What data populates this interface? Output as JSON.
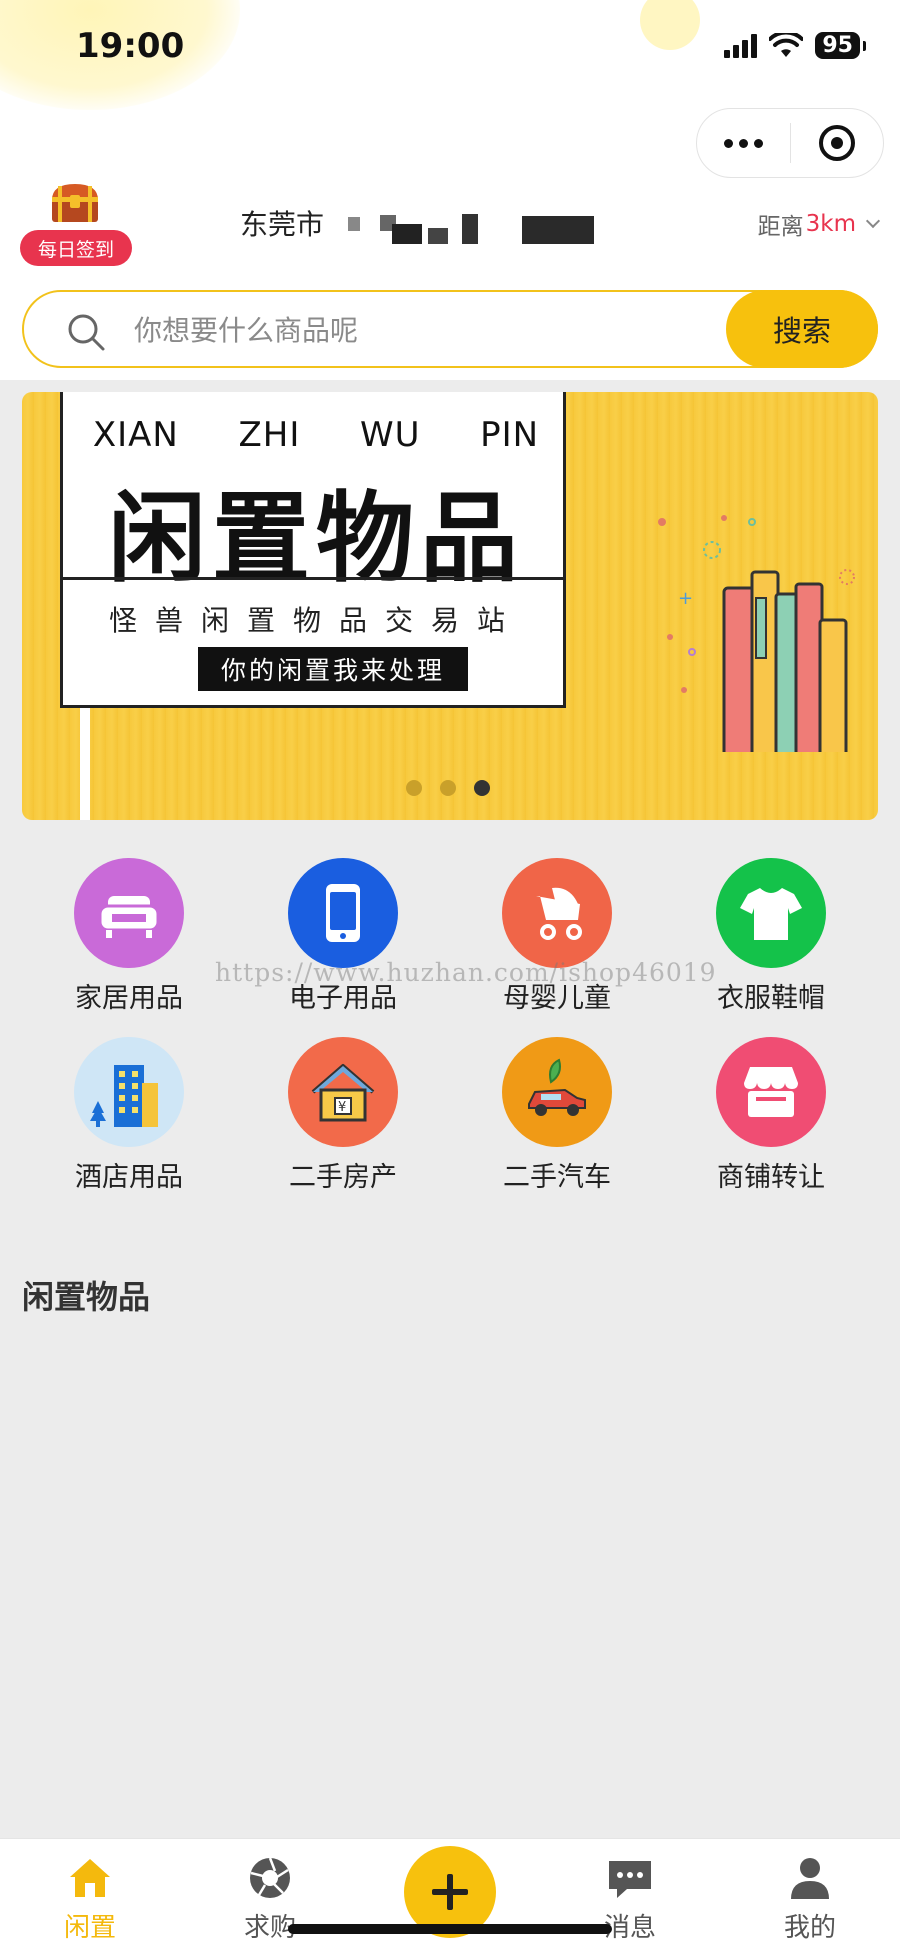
{
  "status_bar": {
    "time": "19:00",
    "battery": "95"
  },
  "header": {
    "checkin_label": "每日签到",
    "location": "东莞市",
    "distance_prefix": "距离",
    "distance_value": "3km"
  },
  "search": {
    "placeholder": "你想要什么商品呢",
    "button": "搜索"
  },
  "banner": {
    "pinyin": [
      "XIAN",
      "ZHI",
      "WU",
      "PIN"
    ],
    "title": "闲置物品",
    "subtitle": "怪兽闲置物品交易站",
    "tagline": "你的闲置我来处理",
    "page_count": 3,
    "active_page": 3
  },
  "categories": [
    {
      "label": "家居用品",
      "icon": "sofa-icon",
      "color": "#c96ad8"
    },
    {
      "label": "电子用品",
      "icon": "phone-icon",
      "color": "#1a5ee0"
    },
    {
      "label": "母婴儿童",
      "icon": "stroller-icon",
      "color": "#f06548"
    },
    {
      "label": "衣服鞋帽",
      "icon": "tshirt-icon",
      "color": "#14c24a"
    },
    {
      "label": "酒店用品",
      "icon": "hotel-icon",
      "color": "#cfe6f6"
    },
    {
      "label": "二手房产",
      "icon": "house-icon",
      "color": "#f26a4a"
    },
    {
      "label": "二手汽车",
      "icon": "car-icon",
      "color": "#f09a16"
    },
    {
      "label": "商铺转让",
      "icon": "shop-icon",
      "color": "#f04d73"
    }
  ],
  "watermark": "https://www.huzhan.com/ishop46019",
  "section_title": "闲置物品",
  "tabbar": {
    "items": [
      {
        "label": "闲置",
        "icon": "home-icon",
        "active": true
      },
      {
        "label": "求购",
        "icon": "aperture-icon",
        "active": false
      },
      {
        "label": "",
        "icon": "plus-icon",
        "active": false
      },
      {
        "label": "消息",
        "icon": "chat-icon",
        "active": false
      },
      {
        "label": "我的",
        "icon": "user-icon",
        "active": false
      }
    ]
  },
  "colors": {
    "accent": "#f7c10d",
    "badge": "#e8344e"
  }
}
